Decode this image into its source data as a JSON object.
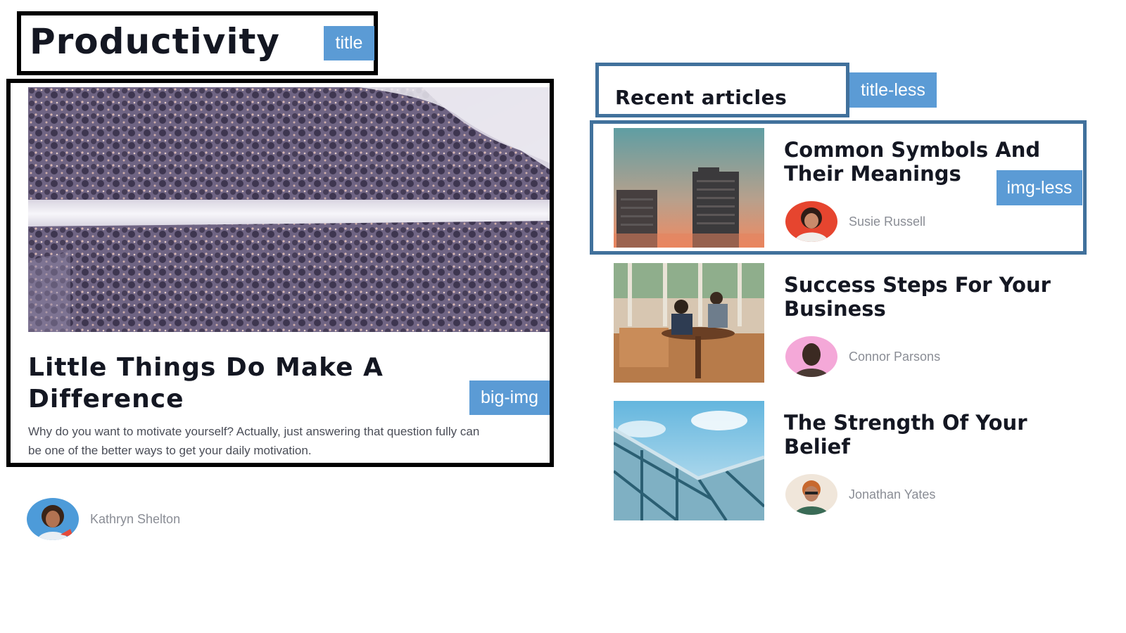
{
  "page": {
    "title": "Productivity"
  },
  "featured": {
    "title": "Little Things Do Make A Difference",
    "excerpt": "Why do you want to motivate yourself? Actually, just answering that question fully can be one of the better ways to get your daily motivation.",
    "author": "Kathryn Shelton",
    "image": "aerial-snowy-forest-road"
  },
  "recent": {
    "heading": "Recent articles",
    "articles": [
      {
        "title": "Common Symbols And Their Meanings",
        "author": "Susie Russell",
        "image": "city-towers-sunset"
      },
      {
        "title": "Success Steps For Your Business",
        "author": "Connor Parsons",
        "image": "office-people-table"
      },
      {
        "title": "The Strength Of Your Belief",
        "author": "Jonathan Yates",
        "image": "glass-building-sky"
      }
    ]
  },
  "annotations": {
    "title": "title",
    "big_img": "big-img",
    "title_less": "title-less",
    "img_less": "img-less"
  },
  "colors": {
    "annotation_fill": "#5b9bd5",
    "annotation_border": "#41719c",
    "heading_text": "#141722",
    "muted_text": "#8a8d95"
  }
}
